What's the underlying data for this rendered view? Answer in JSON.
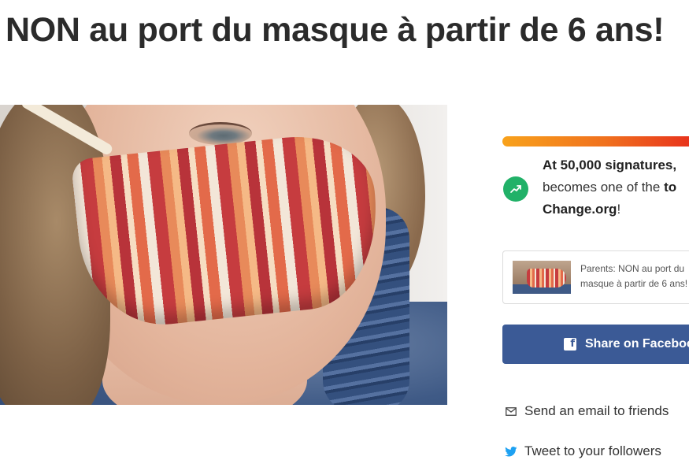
{
  "petition": {
    "title": "NON au port du masque à partir de 6 ans!"
  },
  "sidebar": {
    "progress_color_start": "#f8a21b",
    "progress_color_end": "#e8341c",
    "goal": {
      "prefix": "At 50,000 signatures,",
      "middle": "becomes one of the",
      "bold_tail": "to",
      "site": "Change.org",
      "suffix": "!"
    },
    "preview": {
      "text": "Parents: NON au port du masque à partir de 6 ans!"
    },
    "facebook_button": {
      "label": "Share on Facebook",
      "color": "#3b5a96"
    },
    "email_link": {
      "label": "Send an email to friends",
      "icon": "envelope-icon"
    },
    "tweet_link": {
      "label": "Tweet to your followers",
      "icon": "twitter-bird-icon",
      "color": "#1da1f2"
    }
  },
  "colors": {
    "goal_icon": "#21b168"
  }
}
